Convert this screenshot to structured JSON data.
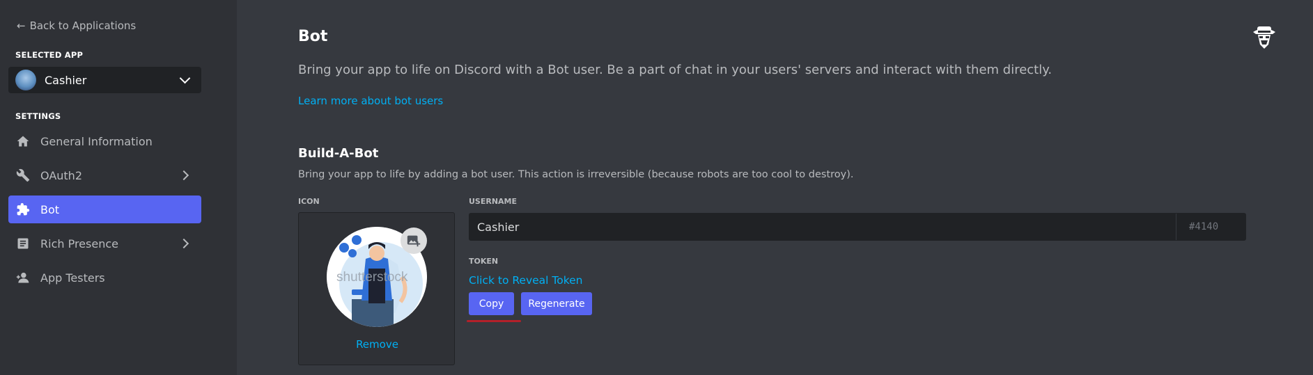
{
  "sidebar": {
    "back_label": "Back to Applications",
    "selected_app_label": "SELECTED APP",
    "app_name": "Cashier",
    "settings_label": "SETTINGS",
    "items": [
      {
        "label": "General Information",
        "icon": "home-icon"
      },
      {
        "label": "OAuth2",
        "icon": "wrench-icon"
      },
      {
        "label": "Bot",
        "icon": "puzzle-icon"
      },
      {
        "label": "Rich Presence",
        "icon": "document-icon"
      },
      {
        "label": "App Testers",
        "icon": "person-icon"
      }
    ]
  },
  "main": {
    "title": "Bot",
    "description": "Bring your app to life on Discord with a Bot user. Be a part of chat in your users' servers and interact with them directly.",
    "learn_more": "Learn more about bot users",
    "build": {
      "title": "Build-A-Bot",
      "description": "Bring your app to life by adding a bot user. This action is irreversible (because robots are too cool to destroy).",
      "icon_label": "ICON",
      "remove_label": "Remove",
      "username_label": "USERNAME",
      "username_value": "Cashier",
      "discriminator": "#4140",
      "token_label": "TOKEN",
      "reveal_label": "Click to Reveal Token",
      "copy_label": "Copy",
      "regenerate_label": "Regenerate"
    }
  },
  "colors": {
    "accent": "#5865f2",
    "link": "#00b0f4",
    "background": "#36393f",
    "sidebar": "#2f3136"
  }
}
